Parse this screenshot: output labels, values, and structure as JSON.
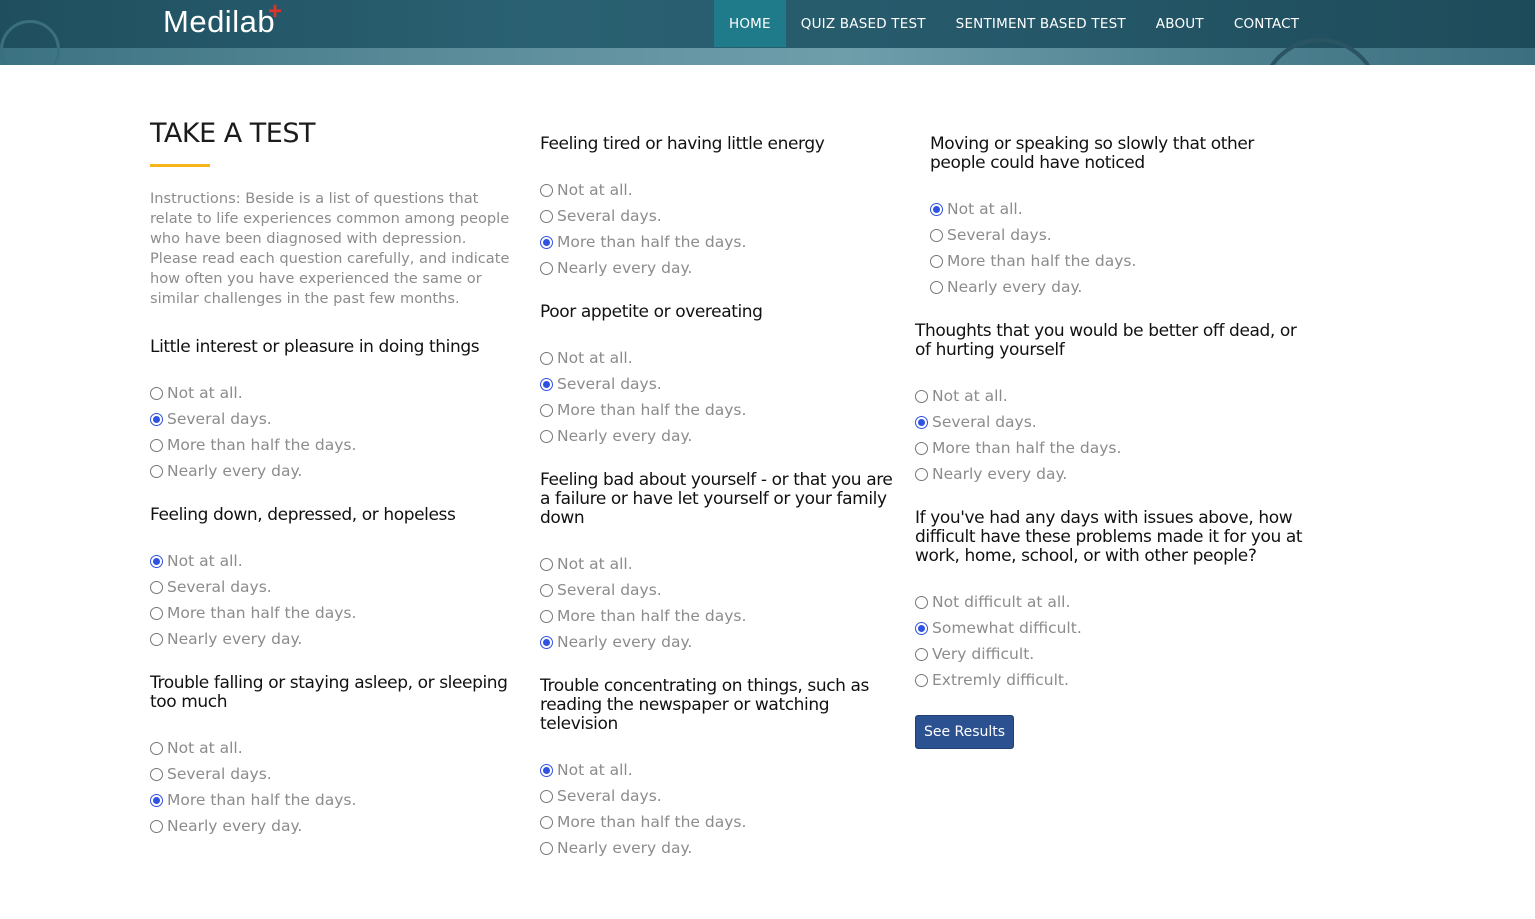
{
  "brand": {
    "logo_text": "Medilab",
    "logo_plus": "+"
  },
  "nav": {
    "items": [
      {
        "label": "HOME",
        "active": true
      },
      {
        "label": "QUIZ BASED TEST",
        "active": false
      },
      {
        "label": "SENTIMENT BASED TEST",
        "active": false
      },
      {
        "label": "ABOUT",
        "active": false
      },
      {
        "label": "CONTACT",
        "active": false
      }
    ]
  },
  "page": {
    "title": "TAKE A TEST",
    "accent_color": "#f5b51b",
    "instructions": "Instructions: Beside is a list of questions that relate to life experiences common among people who have been diagnosed with depression. Please read each question carefully, and indicate how often you have experienced the same or similar challenges in the past few months."
  },
  "options_frequency": [
    "Not at all.",
    "Several days.",
    "More than half the days.",
    "Nearly every day."
  ],
  "options_difficulty": [
    "Not difficult at all.",
    "Somewhat difficult.",
    "Very difficult.",
    "Extremly difficult."
  ],
  "questions": [
    {
      "text": "Little interest or pleasure in doing things",
      "selected": 1
    },
    {
      "text": "Feeling down, depressed, or hopeless",
      "selected": 0
    },
    {
      "text": "Trouble falling or staying asleep, or sleeping too much",
      "selected": 2
    },
    {
      "text": "Feeling tired or having little energy",
      "selected": 2
    },
    {
      "text": "Poor appetite or overeating",
      "selected": 1
    },
    {
      "text": "Feeling bad about yourself - or that you are a failure or have let yourself or your family down",
      "selected": 3
    },
    {
      "text": "Trouble concentrating on things, such as reading the newspaper or watching television",
      "selected": 0
    },
    {
      "text": "Moving or speaking so slowly that other people could have noticed",
      "selected": 0
    },
    {
      "text": "Thoughts that you would be better off dead, or of hurting yourself",
      "selected": 1
    },
    {
      "text": "If you've had any days with issues above, how difficult have these problems made it for you at work, home, school, or with other people?",
      "selected": 1
    }
  ],
  "submit_label": "See Results",
  "selected_color": "#2f52e0",
  "button_color": "#2b5191"
}
